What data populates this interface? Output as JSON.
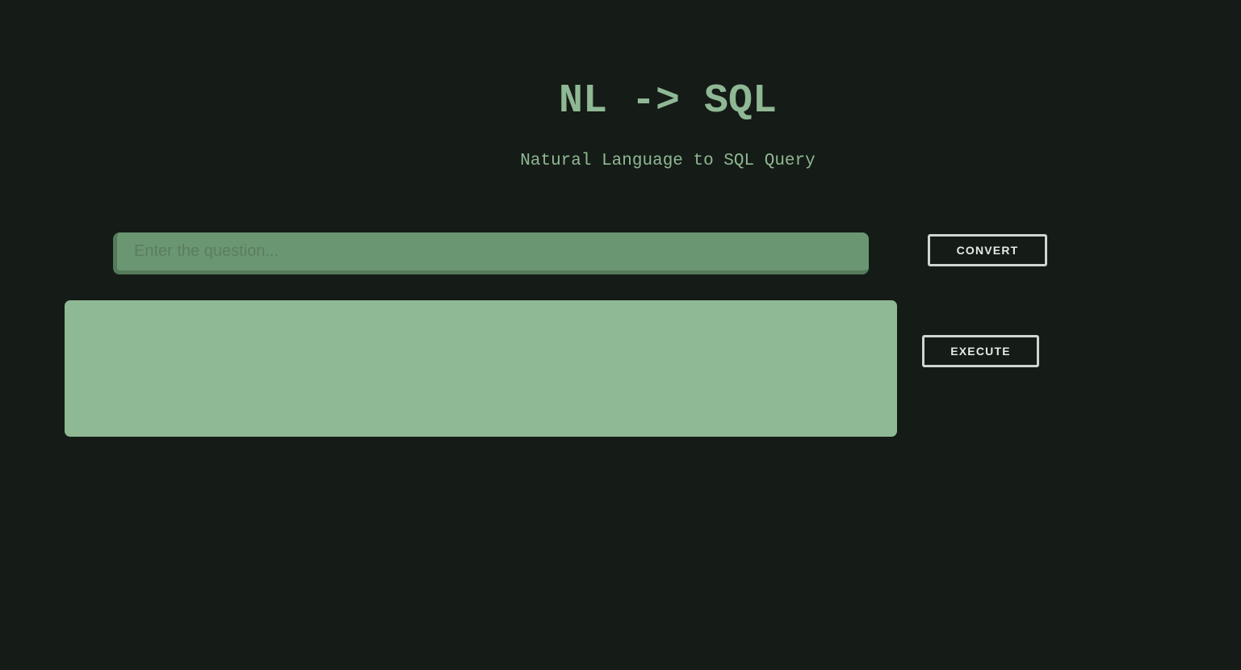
{
  "header": {
    "title": "NL -> SQL",
    "subtitle": "Natural Language to SQL Query"
  },
  "question": {
    "placeholder": "Enter the question...",
    "value": ""
  },
  "sql": {
    "value": ""
  },
  "buttons": {
    "convert_label": "CONVERT",
    "execute_label": "EXECUTE"
  },
  "colors": {
    "background": "#151b16",
    "accent": "#8fb894",
    "input_background": "#6b9672",
    "button_border": "#cfd6cf"
  }
}
